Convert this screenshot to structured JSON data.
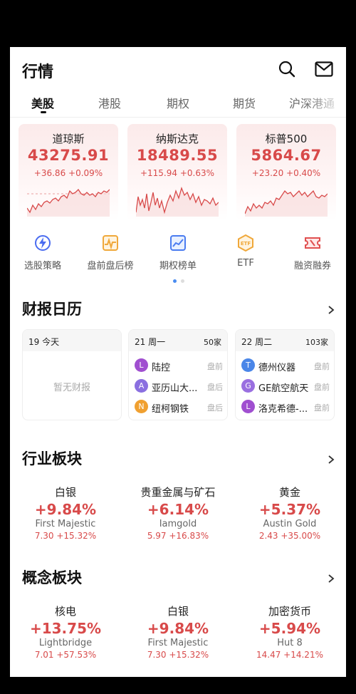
{
  "header": {
    "title": "行情"
  },
  "tabs": [
    {
      "label": "美股"
    },
    {
      "label": "港股"
    },
    {
      "label": "期权"
    },
    {
      "label": "期货"
    },
    {
      "label": "沪深港通"
    }
  ],
  "indices": [
    {
      "name": "道琼斯",
      "price": "43275.91",
      "change": "+36.86 +0.09%"
    },
    {
      "name": "纳斯达克",
      "price": "18489.55",
      "change": "+115.94 +0.63%"
    },
    {
      "name": "标普500",
      "price": "5864.67",
      "change": "+23.20 +0.40%"
    }
  ],
  "shortcuts": [
    {
      "label": "选股策略",
      "icon": "lightning-icon"
    },
    {
      "label": "盘前盘后榜",
      "icon": "pulse-chart-icon"
    },
    {
      "label": "期权榜单",
      "icon": "line-chart-icon"
    },
    {
      "label": "ETF",
      "icon": "etf-badge-icon"
    },
    {
      "label": "融资融券",
      "icon": "margin-ticket-icon"
    }
  ],
  "earnings": {
    "title": "财报日历",
    "days": [
      {
        "date": "19 今天",
        "count": "",
        "empty": "暂无财报",
        "items": []
      },
      {
        "date": "21 周一",
        "count": "50家",
        "empty": "",
        "items": [
          {
            "badge": "L",
            "name": "陆控",
            "time": "盘前",
            "color": "#a04fd0"
          },
          {
            "badge": "A",
            "name": "亚历山大...",
            "time": "盘后",
            "color": "#8a6fe0"
          },
          {
            "badge": "N",
            "name": "纽柯钢铁",
            "time": "盘后",
            "color": "#f0a030"
          }
        ]
      },
      {
        "date": "22 周二",
        "count": "103家",
        "empty": "",
        "items": [
          {
            "badge": "T",
            "name": "德州仪器",
            "time": "盘前",
            "color": "#4a86e8"
          },
          {
            "badge": "G",
            "name": "GE航空航天",
            "time": "盘前",
            "color": "#9a6fe0"
          },
          {
            "badge": "L",
            "name": "洛克希德-...",
            "time": "盘前",
            "color": "#a04fd0"
          }
        ]
      }
    ]
  },
  "industry": {
    "title": "行业板块",
    "items": [
      {
        "name": "白银",
        "pct": "+9.84%",
        "leader": "First Majestic",
        "leader_change": "7.30 +15.32%"
      },
      {
        "name": "贵重金属与矿石",
        "pct": "+6.14%",
        "leader": "Iamgold",
        "leader_change": "5.97 +16.83%"
      },
      {
        "name": "黄金",
        "pct": "+5.37%",
        "leader": "Austin Gold",
        "leader_change": "2.43 +35.00%"
      }
    ]
  },
  "concept": {
    "title": "概念板块",
    "items": [
      {
        "name": "核电",
        "pct": "+13.75%",
        "leader": "Lightbridge",
        "leader_change": "7.01 +57.53%"
      },
      {
        "name": "白银",
        "pct": "+9.84%",
        "leader": "First Majestic",
        "leader_change": "7.30 +15.32%"
      },
      {
        "name": "加密货币",
        "pct": "+5.94%",
        "leader": "Hut 8",
        "leader_change": "14.47 +14.21%"
      }
    ]
  },
  "colors": {
    "up": "#d84a4a",
    "accent": "#4a8cf0"
  }
}
